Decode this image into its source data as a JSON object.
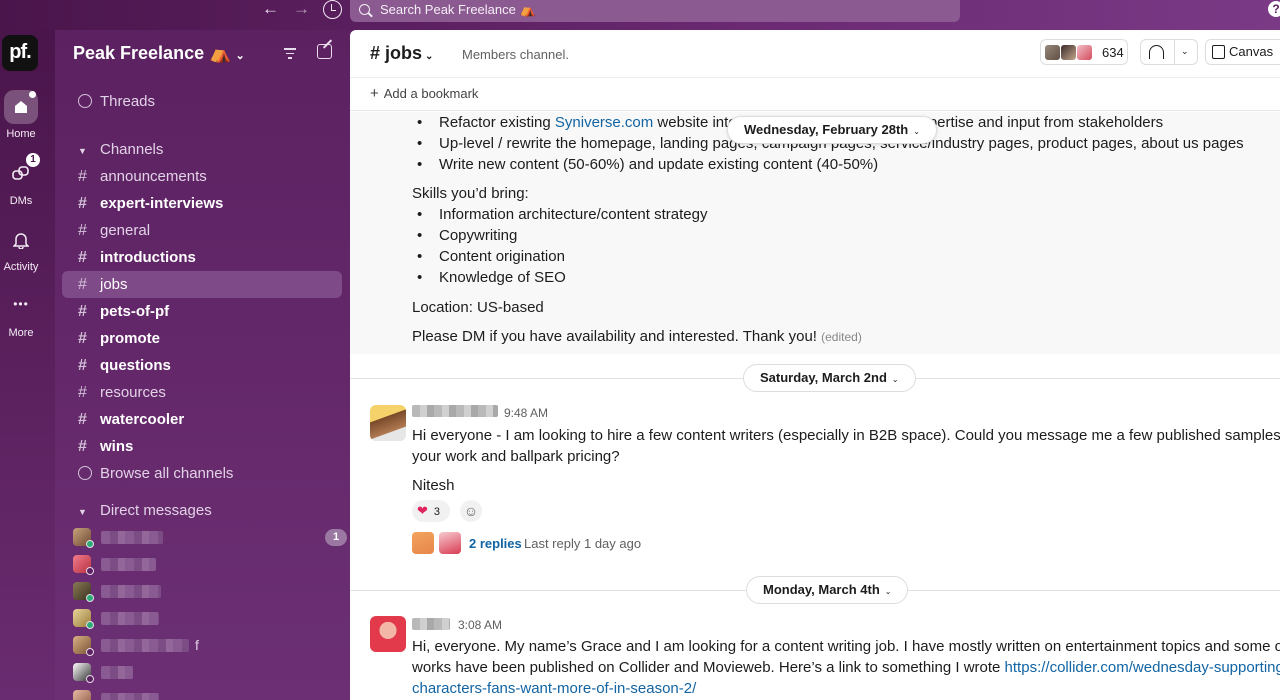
{
  "topbar": {
    "back_icon": "←",
    "forward_icon": "→",
    "search_placeholder": "Search Peak Freelance ⛺",
    "help_icon": "?"
  },
  "rail": {
    "logo": "pf.",
    "items": [
      {
        "label": "Home",
        "icon": "home-icon"
      },
      {
        "label": "DMs",
        "icon": "dms-icon",
        "badge": "1"
      },
      {
        "label": "Activity",
        "icon": "bell-icon"
      },
      {
        "label": "More",
        "icon": "more-icon",
        "glyph": "•••"
      }
    ]
  },
  "sidebar": {
    "workspace_name": "Peak Freelance ⛺",
    "workspace_chevron": "⌄",
    "threads": "Threads",
    "channels_header": "Channels",
    "channels": [
      {
        "name": "announcements",
        "bold": false
      },
      {
        "name": "expert-interviews",
        "bold": true
      },
      {
        "name": "general",
        "bold": false
      },
      {
        "name": "introductions",
        "bold": true
      },
      {
        "name": "jobs",
        "bold": false,
        "active": true
      },
      {
        "name": "pets-of-pf",
        "bold": true
      },
      {
        "name": "promote",
        "bold": true
      },
      {
        "name": "questions",
        "bold": true
      },
      {
        "name": "resources",
        "bold": false
      },
      {
        "name": "watercooler",
        "bold": true
      },
      {
        "name": "wins",
        "bold": true
      }
    ],
    "hash": "#",
    "caret": "▼",
    "browse": "Browse all channels",
    "dm_header": "Direct messages",
    "dm_badge": "1",
    "dm_trailing": "f"
  },
  "header": {
    "channel": "# jobs",
    "chevron": "⌄",
    "description": "Members channel.",
    "member_count": "634",
    "huddle_chevron": "⌄",
    "canvas": "Canvas"
  },
  "bookmark": {
    "plus": "+",
    "label": "Add a bookmark"
  },
  "post1": {
    "bullets_top": [
      {
        "pre": "Refactor existing ",
        "link": "Syniverse.com",
        "post": " website into r",
        "tail": "expertise and input from stakeholders"
      },
      {
        "text": "Up-level / rewrite the homepage, landing pages, campaign pages, service/industry pages, product pages, about us pages"
      },
      {
        "text": "Write new content (50-60%) and update existing content (40-50%)"
      }
    ],
    "skills_header": "Skills you’d bring:",
    "skills": [
      "Information architecture/content strategy",
      "Copywriting",
      "Content origination",
      "Knowledge of SEO"
    ],
    "location": "Location: US-based",
    "closing": "Please DM if you have availability and interested. Thank you!",
    "edited": "(edited)"
  },
  "dates": {
    "sticky": "Wednesday, February 28th",
    "d1": "Saturday, March 2nd",
    "d2": "Monday, March 4th",
    "chev": "⌄"
  },
  "post2": {
    "time": "9:48 AM",
    "line1": "Hi everyone - I am looking to hire a few content writers (especially in B2B space). Could you message me a few published samples of",
    "line2": "your work and ballpark pricing?",
    "sign": "Nitesh",
    "reaction_emoji": "❤",
    "reaction_count": "3",
    "add_reaction": "☺",
    "replies": "2 replies",
    "last_reply": "Last reply 1 day ago"
  },
  "post3": {
    "time": "3:08 AM",
    "line1": "Hi, everyone. My name’s Grace and I am looking for a content writing job. I have mostly written on entertainment topics and some of",
    "line2": "works have been published on Collider and Movieweb. Here’s a link to something I wrote ",
    "link1": "https://collider.com/wednesday-supporting-",
    "link2": "characters-fans-want-more-of-in-season-2/"
  },
  "colors": {
    "sidebar": "#5b2160",
    "active_channel": "#7f4a88",
    "link": "#1264a3",
    "rail": "#4a154b"
  }
}
